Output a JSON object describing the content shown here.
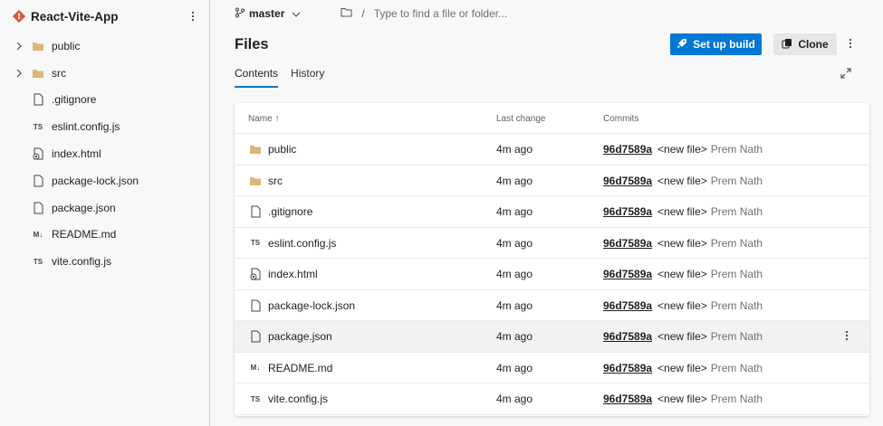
{
  "repo": {
    "name": "React-Vite-App"
  },
  "tree": [
    {
      "label": "public",
      "type": "folder",
      "expandable": true
    },
    {
      "label": "src",
      "type": "folder",
      "expandable": true
    },
    {
      "label": ".gitignore",
      "type": "file"
    },
    {
      "label": "eslint.config.js",
      "type": "ts"
    },
    {
      "label": "index.html",
      "type": "html"
    },
    {
      "label": "package-lock.json",
      "type": "file"
    },
    {
      "label": "package.json",
      "type": "file"
    },
    {
      "label": "README.md",
      "type": "md"
    },
    {
      "label": "vite.config.js",
      "type": "ts"
    }
  ],
  "topbar": {
    "branch": "master",
    "path_sep": "/",
    "path_placeholder": "Type to find a file or folder..."
  },
  "page": {
    "title": "Files"
  },
  "buttons": {
    "setup_build": "Set up build",
    "clone": "Clone"
  },
  "tabs": [
    {
      "label": "Contents",
      "active": true
    },
    {
      "label": "History",
      "active": false
    }
  ],
  "table": {
    "headers": {
      "name": "Name ↑",
      "last_change": "Last change",
      "commits": "Commits"
    },
    "rows": [
      {
        "name": "public",
        "type": "folder",
        "change": "4m ago",
        "hash": "96d7589a",
        "message": "<new file>",
        "author": "Prem Nath"
      },
      {
        "name": "src",
        "type": "folder",
        "change": "4m ago",
        "hash": "96d7589a",
        "message": "<new file>",
        "author": "Prem Nath"
      },
      {
        "name": ".gitignore",
        "type": "file",
        "change": "4m ago",
        "hash": "96d7589a",
        "message": "<new file>",
        "author": "Prem Nath"
      },
      {
        "name": "eslint.config.js",
        "type": "ts",
        "change": "4m ago",
        "hash": "96d7589a",
        "message": "<new file>",
        "author": "Prem Nath"
      },
      {
        "name": "index.html",
        "type": "html",
        "change": "4m ago",
        "hash": "96d7589a",
        "message": "<new file>",
        "author": "Prem Nath"
      },
      {
        "name": "package-lock.json",
        "type": "file",
        "change": "4m ago",
        "hash": "96d7589a",
        "message": "<new file>",
        "author": "Prem Nath"
      },
      {
        "name": "package.json",
        "type": "file",
        "change": "4m ago",
        "hash": "96d7589a",
        "message": "<new file>",
        "author": "Prem Nath"
      },
      {
        "name": "README.md",
        "type": "md",
        "change": "4m ago",
        "hash": "96d7589a",
        "message": "<new file>",
        "author": "Prem Nath"
      },
      {
        "name": "vite.config.js",
        "type": "ts",
        "change": "4m ago",
        "hash": "96d7589a",
        "message": "<new file>",
        "author": "Prem Nath"
      }
    ]
  },
  "icons": {
    "repo": "git-repo-icon",
    "folder": "folder-icon",
    "file": "file-icon",
    "ts": "ts-file-icon",
    "md": "markdown-icon",
    "html": "html-file-icon"
  },
  "colors": {
    "accent": "#0078d4",
    "folder": "#dcb67a",
    "repo_icon": "#e0523a"
  }
}
